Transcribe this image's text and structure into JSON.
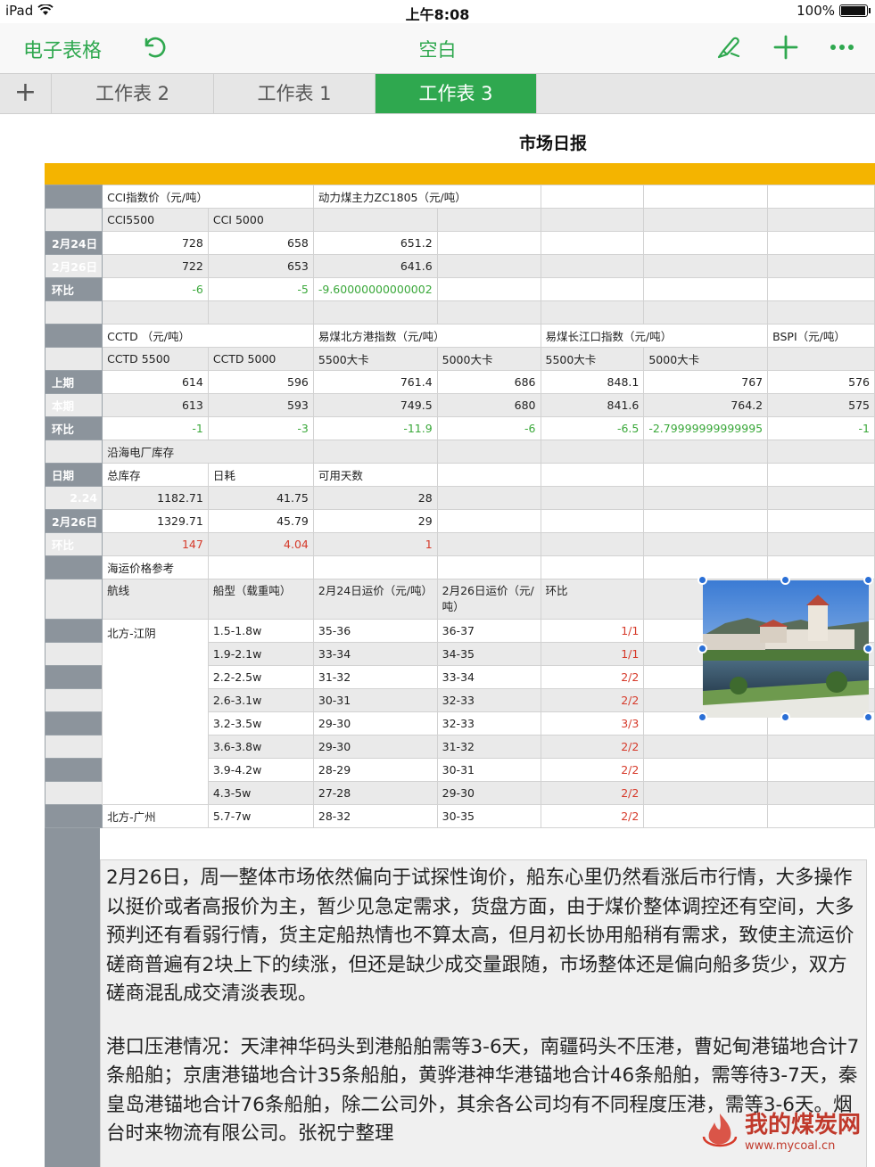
{
  "status_bar": {
    "device": "iPad",
    "time": "上午8:08",
    "battery": "100%",
    "battery_level": 1.0
  },
  "toolbar": {
    "app_name": "电子表格",
    "doc_title": "空白"
  },
  "tabs": [
    {
      "label": "工作表 2",
      "active": false
    },
    {
      "label": "工作表 1",
      "active": false
    },
    {
      "label": "工作表 3",
      "active": true
    }
  ],
  "colors": {
    "accent": "#2fa84f",
    "header_bar": "#f4b400",
    "row_header": "#8c949c",
    "positive": "#3aa83a",
    "negative": "#d63a2a"
  },
  "sheet": {
    "title": "市场日报",
    "cci": {
      "title": "CCI指数价（元/吨）",
      "futures_title": "动力煤主力ZC1805（元/吨）",
      "headers": [
        "CCI5500",
        "CCI  5000"
      ],
      "rows": [
        {
          "label": "2月24日",
          "values": [
            "728",
            "658",
            "651.2"
          ]
        },
        {
          "label": "2月26日",
          "values": [
            "722",
            "653",
            "641.6"
          ]
        },
        {
          "label": "环比",
          "values": [
            "-6",
            "-5",
            "-9.60000000000002"
          ]
        }
      ]
    },
    "cctd": {
      "title": "CCTD （元/吨）",
      "north_title": "易煤北方港指数（元/吨）",
      "yangtze_title": "易煤长江口指数（元/吨）",
      "bspi_title": "BSPI（元/吨）",
      "headers": [
        "CCTD 5500",
        "CCTD 5000",
        "5500大卡",
        "5000大卡",
        "5500大卡",
        "5000大卡"
      ],
      "rows": [
        {
          "label": "上期",
          "values": [
            "614",
            "596",
            "761.4",
            "686",
            "848.1",
            "767",
            "576"
          ]
        },
        {
          "label": "本期",
          "values": [
            "613",
            "593",
            "749.5",
            "680",
            "841.6",
            "764.2",
            "575"
          ]
        },
        {
          "label": "环比",
          "values": [
            "-1",
            "-3",
            "-11.9",
            "-6",
            "-6.5",
            "-2.79999999999995",
            "-1"
          ]
        }
      ]
    },
    "inventory": {
      "title": "沿海电厂库存",
      "date_label": "日期",
      "headers": [
        "总库存",
        "日耗",
        "可用天数"
      ],
      "rows": [
        {
          "label": "2.24",
          "values": [
            "1182.71",
            "41.75",
            "28"
          ]
        },
        {
          "label": "2月26日",
          "values": [
            "1329.71",
            "45.79",
            "29"
          ]
        },
        {
          "label": "环比",
          "values": [
            "147",
            "4.04",
            "1"
          ]
        }
      ]
    },
    "freight": {
      "title": "海运价格参考",
      "headers": [
        "航线",
        "船型（载重吨）",
        "2月24日运价（元/吨）",
        "2月26日运价（元/吨）",
        "环比"
      ],
      "route1": "北方-江阴",
      "route2": "北方-广州",
      "rows": [
        [
          "1.5-1.8w",
          "35-36",
          "36-37",
          "1/1"
        ],
        [
          "1.9-2.1w",
          "33-34",
          "34-35",
          "1/1"
        ],
        [
          "2.2-2.5w",
          "31-32",
          "33-34",
          "2/2"
        ],
        [
          "2.6-3.1w",
          "30-31",
          "32-33",
          "2/2"
        ],
        [
          "3.2-3.5w",
          "29-30",
          "32-33",
          "3/3"
        ],
        [
          "3.6-3.8w",
          "29-30",
          "31-32",
          "2/2"
        ],
        [
          "3.9-4.2w",
          "28-29",
          "30-31",
          "2/2"
        ],
        [
          "4.3-5w",
          "27-28",
          "29-30",
          "2/2"
        ],
        [
          "5.7-7w",
          "28-32",
          "30-35",
          "2/2"
        ]
      ]
    },
    "note": [
      "2月26日，周一整体市场依然偏向于试探性询价，船东心里仍然看涨后市行情，大多操作以挺价或者高报价为主，暂少见急定需求，货盘方面，由于煤价整体调控还有空间，大多预判还有看弱行情，货主定船热情也不算太高，但月初长协用船稍有需求，致使主流运价磋商普遍有2块上下的续涨，但还是缺少成交量跟随，市场整体还是偏向船多货少，双方磋商混乱成交清淡表现。",
      "港口压港情况：天津神华码头到港船舶需等3-6天，南疆码头不压港，曹妃甸港锚地合计7条船舶；京唐港锚地合计35条船舶，黄骅港神华港锚地合计46条船舶，需等待3-7天，秦皇岛港锚地合计76条船舶，除二公司外，其余各公司均有不同程度压港，需等3-6天。烟台时来物流有限公司。张祝宁整理"
    ]
  },
  "watermark": {
    "text": "我的煤炭网",
    "url": "www.mycoal.cn"
  }
}
